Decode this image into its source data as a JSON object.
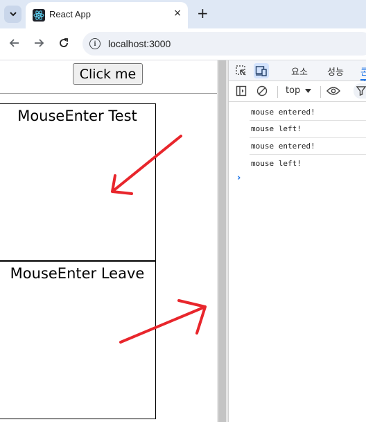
{
  "browser": {
    "tab_list_icon": "chevron-down-icon",
    "tab": {
      "title": "React App",
      "favicon": "react-icon",
      "close": "×"
    },
    "new_tab": "+",
    "url": "localhost:3000"
  },
  "page": {
    "button_label": "Click me",
    "box1_title": "MouseEnter Test",
    "box2_title": "MouseEnter Leave"
  },
  "annotations": {
    "arrow_color": "#e8262c"
  },
  "devtools": {
    "tabs": [
      {
        "label": "요소"
      },
      {
        "label": "성능"
      },
      {
        "label": "콘솔"
      }
    ],
    "context": "top",
    "console_logs": [
      "mouse entered!",
      "mouse left!",
      "mouse entered!",
      "mouse left!"
    ],
    "prompt": "›"
  }
}
